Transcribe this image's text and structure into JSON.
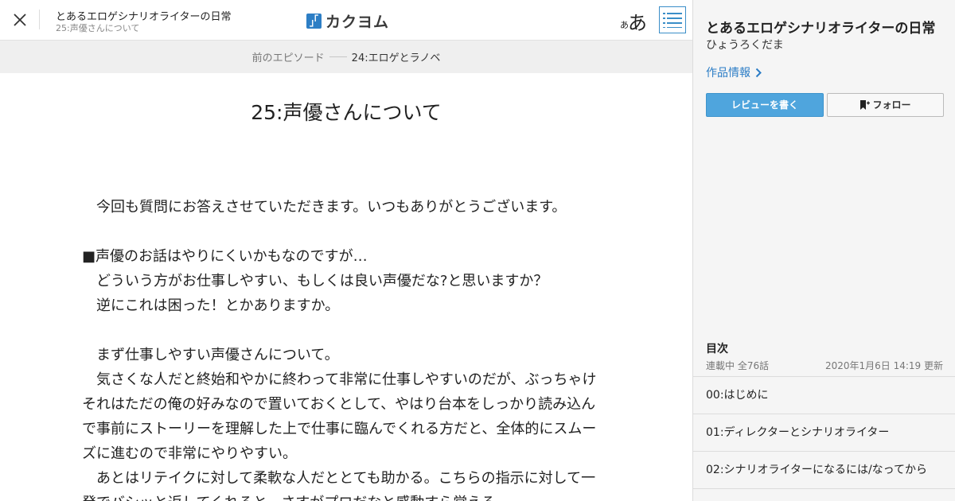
{
  "header": {
    "work_title": "とあるエロゲシナリオライターの日常",
    "episode_subtitle": "25:声優さんについて",
    "logo_text": "カクヨム",
    "font_small": "あ",
    "font_large": "あ",
    "icons": [
      "close-icon",
      "logo-icon",
      "toc-list-icon"
    ]
  },
  "episode_nav": {
    "prev_label": "前のエピソード",
    "prev_title": "24:エロゲとラノベ"
  },
  "episode": {
    "title": "25:声優さんについて",
    "lines": [
      "　今回も質問にお答えさせていただきます。いつもありがとうございます。",
      "",
      "■声優のお話はやりにくいかもなのですが…",
      "　どういう方がお仕事しやすい、もしくは良い声優だな?と思いますか？",
      "　逆にこれは困った！とかありますか。",
      "",
      "　まず仕事しやすい声優さんについて。",
      "　気さくな人だと終始和やかに終わって非常に仕事しやすいのだが、ぶっちゃけ",
      "それはただの俺の好みなので置いておくとして、やはり台本をしっかり読み込ん",
      "で事前にストーリーを理解した上で仕事に臨んでくれる方だと、全体的にスムー",
      "ズに進むので非常にやりやすい。",
      "　あとはリテイクに対して柔軟な人だととても助かる。こちらの指示に対して一",
      "発でバシッと返してくれると、さすがプロだなと感動すら覚える。"
    ]
  },
  "sidebar": {
    "title": "とあるエロゲシナリオライターの日常",
    "author": "ひょうろくだま",
    "info_link": "作品情報",
    "review_button": "レビューを書く",
    "follow_button": "フォロー",
    "toc_heading": "目次",
    "toc_status": "連載中 全76話",
    "toc_updated": "2020年1月6日 14:19 更新",
    "toc_items": [
      "00:はじめに",
      "01:ディレクターとシナリオライター",
      "02:シナリオライターになるには/なってから"
    ]
  },
  "colors": {
    "accent": "#2c7dc6",
    "review_button": "#4fa5dd",
    "nav_bar": "#efefef",
    "sidebar_bg": "#f5f5f5"
  }
}
